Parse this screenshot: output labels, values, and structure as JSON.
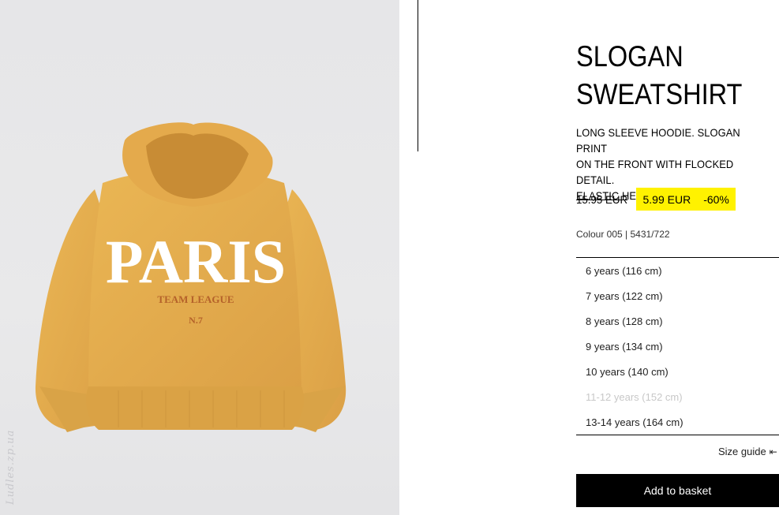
{
  "product": {
    "title_line1": "SLOGAN",
    "title_line2": "SWEATSHIRT",
    "description_line1": "LONG SLEEVE HOODIE. SLOGAN PRINT",
    "description_line2": "ON THE FRONT WITH FLOCKED DETAIL.",
    "description_line3": "ELASTIC HEM. FLEECE LINING.",
    "old_price": "15.95 EUR",
    "sale_price": "5.99 EUR",
    "discount": "-60%",
    "colour": "Colour 005 | 5431/722"
  },
  "image": {
    "print_main": "PARIS",
    "print_sub": "TEAM LEAGUE",
    "print_number": "N.7",
    "watermark": "Ludles.zp.ua"
  },
  "sizes": [
    {
      "label": "6 years (116 cm)",
      "available": true
    },
    {
      "label": "7 years (122 cm)",
      "available": true
    },
    {
      "label": "8 years (128 cm)",
      "available": true
    },
    {
      "label": "9 years (134 cm)",
      "available": true
    },
    {
      "label": "10 years (140 cm)",
      "available": true
    },
    {
      "label": "11-12 years (152 cm)",
      "available": false
    },
    {
      "label": "13-14 years (164 cm)",
      "available": true
    }
  ],
  "size_guide": {
    "label": "Size guide",
    "icon": "arrow-bar-left-icon"
  },
  "actions": {
    "add_to_basket": "Add to basket"
  },
  "colors": {
    "sale_highlight": "#fff200",
    "hoodie": "#e8b04e",
    "button": "#000000"
  }
}
